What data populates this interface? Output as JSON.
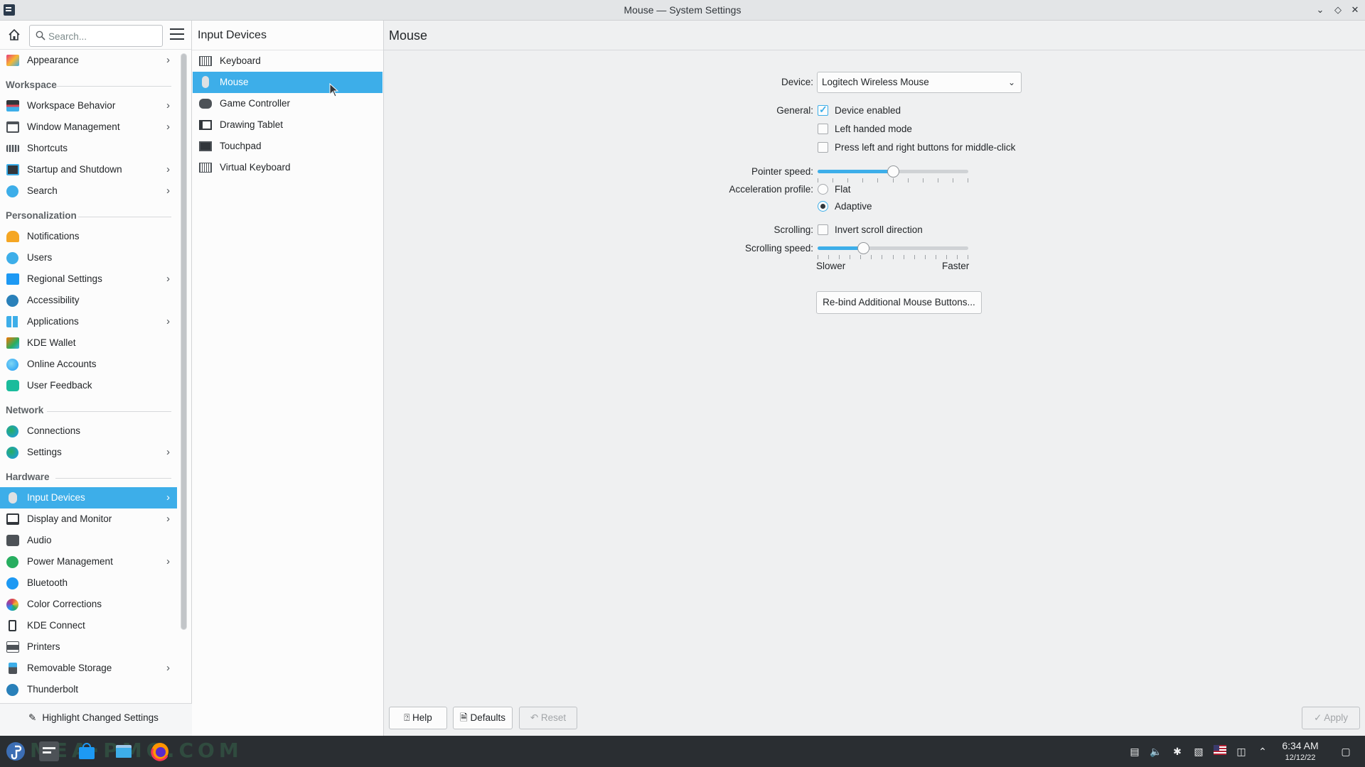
{
  "window": {
    "title": "Mouse — System Settings",
    "controls": [
      "minimize",
      "maximize",
      "close"
    ]
  },
  "sidebar": {
    "search_placeholder": "Search...",
    "items": [
      {
        "label": "Appearance",
        "icon": "appearance-icon",
        "chevron": true
      },
      {
        "header": "Workspace"
      },
      {
        "label": "Workspace Behavior",
        "icon": "workspace-behavior-icon",
        "chevron": true
      },
      {
        "label": "Window Management",
        "icon": "window-management-icon",
        "chevron": true
      },
      {
        "label": "Shortcuts",
        "icon": "shortcuts-icon",
        "chevron": false
      },
      {
        "label": "Startup and Shutdown",
        "icon": "startup-icon",
        "chevron": true
      },
      {
        "label": "Search",
        "icon": "search-settings-icon",
        "chevron": true
      },
      {
        "header": "Personalization"
      },
      {
        "label": "Notifications",
        "icon": "bell-icon",
        "chevron": false
      },
      {
        "label": "Users",
        "icon": "users-icon",
        "chevron": false
      },
      {
        "label": "Regional Settings",
        "icon": "regional-icon",
        "chevron": true
      },
      {
        "label": "Accessibility",
        "icon": "accessibility-icon",
        "chevron": false
      },
      {
        "label": "Applications",
        "icon": "applications-icon",
        "chevron": true
      },
      {
        "label": "KDE Wallet",
        "icon": "wallet-icon",
        "chevron": false
      },
      {
        "label": "Online Accounts",
        "icon": "online-accounts-icon",
        "chevron": false
      },
      {
        "label": "User Feedback",
        "icon": "feedback-icon",
        "chevron": false
      },
      {
        "header": "Network"
      },
      {
        "label": "Connections",
        "icon": "connections-icon",
        "chevron": false
      },
      {
        "label": "Settings",
        "icon": "network-settings-icon",
        "chevron": true
      },
      {
        "header": "Hardware"
      },
      {
        "label": "Input Devices",
        "icon": "input-devices-icon",
        "chevron": true,
        "selected": true
      },
      {
        "label": "Display and Monitor",
        "icon": "display-icon",
        "chevron": true
      },
      {
        "label": "Audio",
        "icon": "audio-icon",
        "chevron": false
      },
      {
        "label": "Power Management",
        "icon": "power-icon",
        "chevron": true
      },
      {
        "label": "Bluetooth",
        "icon": "bluetooth-icon",
        "chevron": false
      },
      {
        "label": "Color Corrections",
        "icon": "color-corrections-icon",
        "chevron": false
      },
      {
        "label": "KDE Connect",
        "icon": "kde-connect-icon",
        "chevron": false
      },
      {
        "label": "Printers",
        "icon": "printer-icon",
        "chevron": false
      },
      {
        "label": "Removable Storage",
        "icon": "removable-storage-icon",
        "chevron": true
      },
      {
        "label": "Thunderbolt",
        "icon": "thunderbolt-icon",
        "chevron": false
      }
    ],
    "highlight_button": "Highlight Changed Settings"
  },
  "subpanel": {
    "title": "Input Devices",
    "items": [
      {
        "label": "Keyboard",
        "icon": "keyboard-icon"
      },
      {
        "label": "Mouse",
        "icon": "mouse-icon",
        "selected": true
      },
      {
        "label": "Game Controller",
        "icon": "gamepad-icon"
      },
      {
        "label": "Drawing Tablet",
        "icon": "tablet-icon"
      },
      {
        "label": "Touchpad",
        "icon": "touchpad-icon"
      },
      {
        "label": "Virtual Keyboard",
        "icon": "virtual-keyboard-icon"
      }
    ]
  },
  "main": {
    "title": "Mouse",
    "device_label": "Device:",
    "device_value": "Logitech Wireless Mouse",
    "general_label": "General:",
    "device_enabled": "Device enabled",
    "device_enabled_checked": true,
    "left_handed": "Left handed mode",
    "left_handed_checked": false,
    "middle_click": "Press left and right buttons for middle-click",
    "middle_click_checked": false,
    "pointer_speed_label": "Pointer speed:",
    "pointer_speed_fraction": 0.5,
    "accel_label": "Acceleration profile:",
    "accel_flat": "Flat",
    "accel_adaptive": "Adaptive",
    "accel_selected": "Adaptive",
    "scrolling_label": "Scrolling:",
    "invert_scroll": "Invert scroll direction",
    "invert_scroll_checked": false,
    "scroll_speed_label": "Scrolling speed:",
    "scroll_speed_fraction": 0.3,
    "slower": "Slower",
    "faster": "Faster",
    "rebind_button": "Re-bind Additional Mouse Buttons..."
  },
  "footer": {
    "help": "Help",
    "defaults": "Defaults",
    "reset": "Reset",
    "apply": "Apply"
  },
  "taskbar": {
    "watermark": "MEA·PMO.COM",
    "time": "6:34 AM",
    "date": "12/12/22"
  },
  "colors": {
    "accent": "#3daee9",
    "taskbar": "#2a2e32"
  }
}
